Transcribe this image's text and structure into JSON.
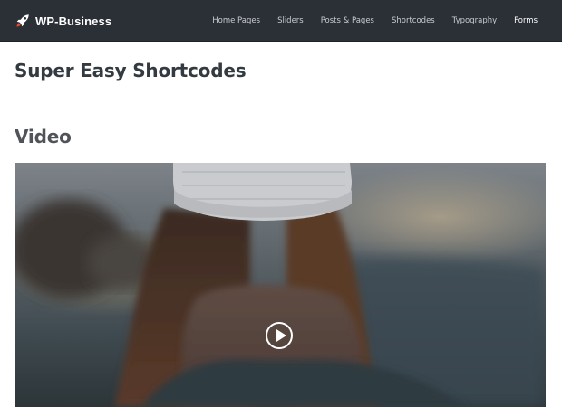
{
  "header": {
    "brand": "WP-Business",
    "nav": [
      {
        "label": "Home Pages",
        "active": false
      },
      {
        "label": "Sliders",
        "active": false
      },
      {
        "label": "Posts & Pages",
        "active": false
      },
      {
        "label": "Shortcodes",
        "active": false
      },
      {
        "label": "Typography",
        "active": false
      },
      {
        "label": "Forms",
        "active": true
      }
    ]
  },
  "main": {
    "title": "Super Easy Shortcodes",
    "section_title": "Video",
    "video": {
      "play_icon": "play-circle-icon"
    }
  },
  "colors": {
    "header_bg": "#2b2f36",
    "nav_text": "#c9ccd1",
    "nav_active": "#ffffff",
    "title_text": "#333a40"
  }
}
